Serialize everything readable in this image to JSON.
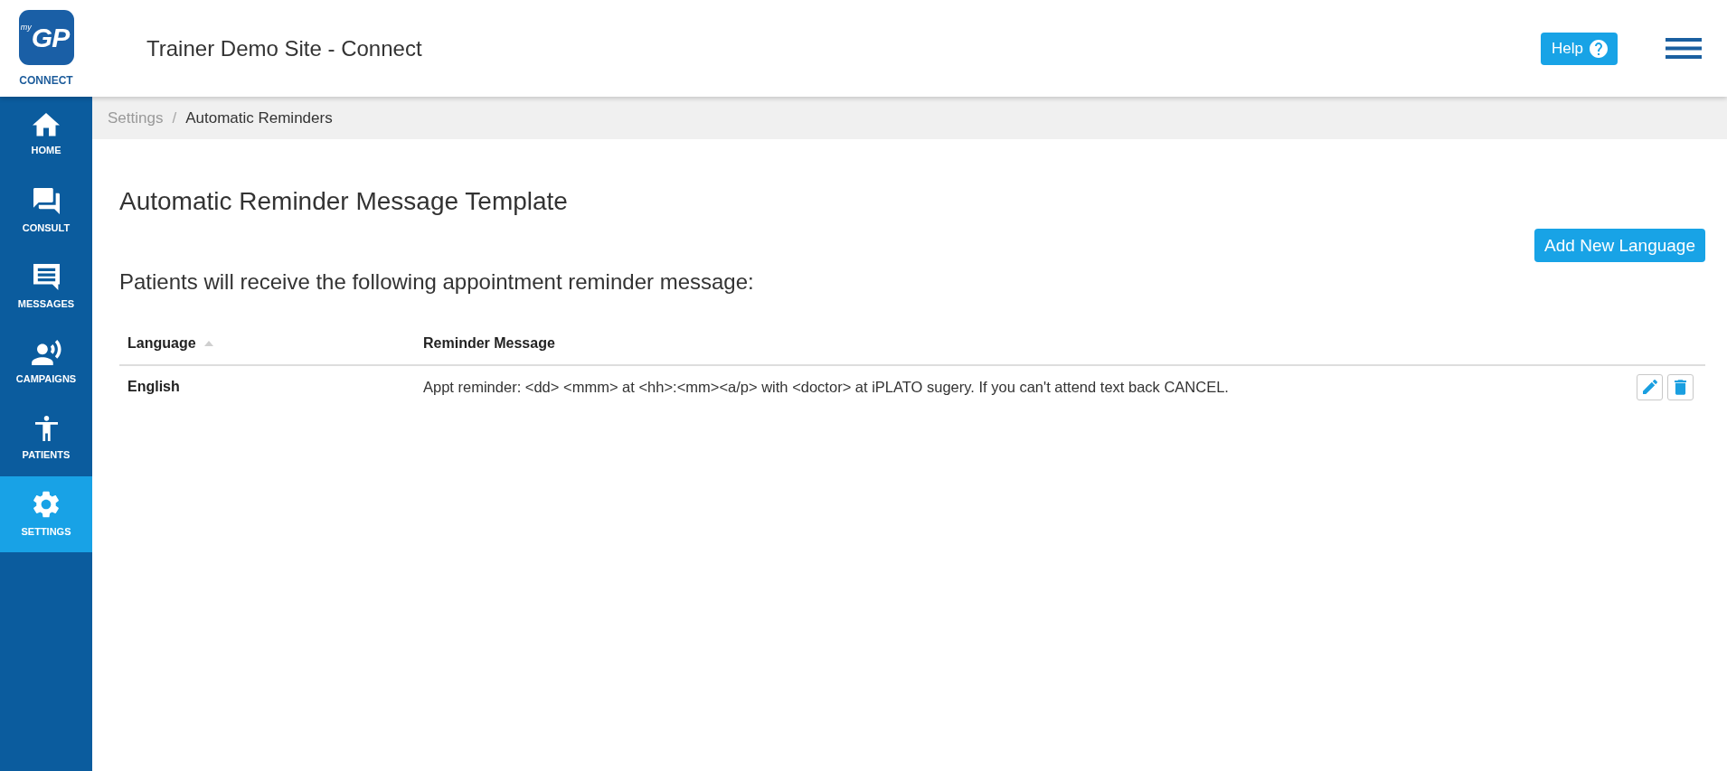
{
  "logo": {
    "prefix": "my",
    "name": "GP",
    "caption": "CONNECT"
  },
  "header": {
    "title": "Trainer Demo Site - Connect",
    "help_label": "Help"
  },
  "sidebar": {
    "items": [
      {
        "kind": "home",
        "label": "HOME",
        "selected": false
      },
      {
        "kind": "consult",
        "label": "CONSULT",
        "selected": false
      },
      {
        "kind": "messages",
        "label": "MESSAGES",
        "selected": false
      },
      {
        "kind": "campaigns",
        "label": "CAMPAIGNS",
        "selected": false
      },
      {
        "kind": "patients",
        "label": "PATIENTS",
        "selected": false
      },
      {
        "kind": "settings",
        "label": "SETTINGS",
        "selected": true
      }
    ]
  },
  "breadcrumb": {
    "separator": "/",
    "items": [
      {
        "label": "Settings",
        "current": false
      },
      {
        "label": "Automatic Reminders",
        "current": true
      }
    ]
  },
  "page": {
    "title": "Automatic Reminder Message Template",
    "add_button": "Add New Language",
    "intro": "Patients will receive the following appointment reminder message:"
  },
  "table": {
    "columns": [
      {
        "label": "Language",
        "sorted": true
      },
      {
        "label": "Reminder Message",
        "sorted": false
      }
    ],
    "rows": [
      {
        "language": "English",
        "message": "Appt reminder: <dd> <mmm> at <hh>:<mm><a/p> with <doctor> at iPLATO sugery. If you can't attend text back CANCEL."
      }
    ]
  }
}
